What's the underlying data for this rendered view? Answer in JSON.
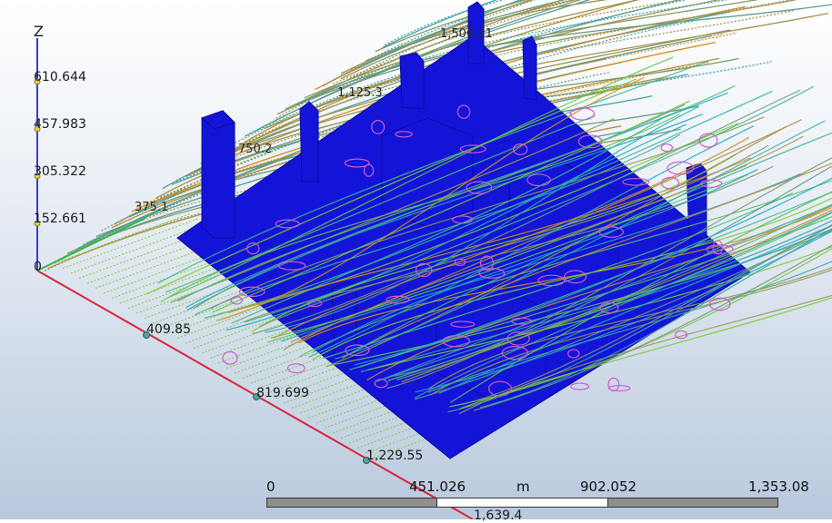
{
  "axes": {
    "z": {
      "label": "Z",
      "ticks": [
        "610.644",
        "457.983",
        "305.322",
        "152.661",
        "0"
      ],
      "color": "#3b3bd6"
    },
    "x": {
      "ticks": [
        "409.85",
        "819.699",
        "1,229.55",
        "1,639.4"
      ],
      "color": "#d9243a"
    },
    "y": {
      "color": "#2fb84a"
    }
  },
  "floating_labels": [
    "1,500.51",
    "1,125.3",
    "750.2",
    "375.1"
  ],
  "scale_bar": {
    "labels": [
      "0",
      "451.026",
      "902.052",
      "1,353.08"
    ],
    "unit": "m"
  },
  "colors": {
    "buildings": "#1414d8",
    "streamline_low": "#1aa7c9",
    "streamline_mid": "#7ccf2a",
    "streamline_high": "#d98a1a"
  }
}
